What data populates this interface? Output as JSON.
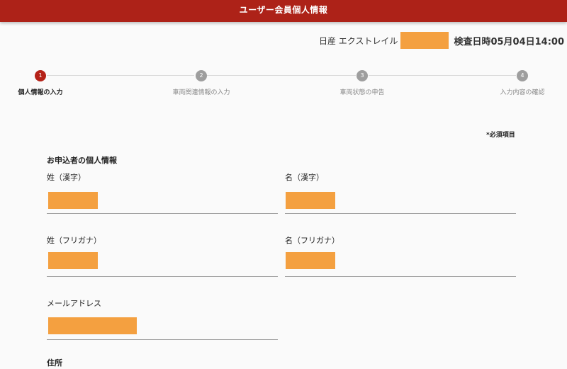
{
  "header": {
    "title": "ユーザー会員個人情報"
  },
  "vehicle": {
    "name": "日産 エクストレイル",
    "inspection": "検査日時05月04日14:00"
  },
  "stepper": {
    "steps": [
      {
        "number": "1",
        "label": "個人情報の入力",
        "active": true
      },
      {
        "number": "2",
        "label": "車両関連情報の入力",
        "active": false
      },
      {
        "number": "3",
        "label": "車両状態の申告",
        "active": false
      },
      {
        "number": "4",
        "label": "入力内容の確認",
        "active": false
      }
    ]
  },
  "form": {
    "required_note": "*必須項目",
    "section_title": "お申込者の個人情報",
    "fields": {
      "last_name_kanji": {
        "label": "姓（漢字）"
      },
      "first_name_kanji": {
        "label": "名（漢字）"
      },
      "last_name_kana": {
        "label": "姓（フリガナ）"
      },
      "first_name_kana": {
        "label": "名（フリガナ）"
      },
      "email": {
        "label": "メールアドレス"
      }
    },
    "address_title": "住所"
  },
  "colors": {
    "header": "#ad2218",
    "active_step": "#b52218",
    "inactive_step": "#9e9e9e",
    "redaction": "#f4a040"
  }
}
